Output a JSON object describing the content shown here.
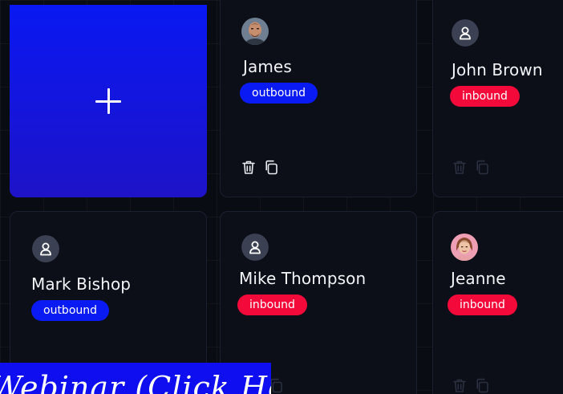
{
  "add_card": {
    "icon": "plus-icon"
  },
  "contacts": [
    {
      "name": "James",
      "direction": "outbound",
      "avatar": "photo-male",
      "actions_active": true
    },
    {
      "name": "John Brown",
      "direction": "inbound",
      "avatar": "person-placeholder",
      "actions_active": false
    },
    {
      "name": "Mark Bishop",
      "direction": "outbound",
      "avatar": "person-placeholder",
      "actions_active": false
    },
    {
      "name": "Mike Thompson",
      "direction": "inbound",
      "avatar": "person-placeholder",
      "actions_active": false
    },
    {
      "name": "Jeanne",
      "direction": "inbound",
      "avatar": "photo-female",
      "actions_active": false
    }
  ],
  "icons": {
    "delete": "trash-icon",
    "copy": "copy-icon"
  },
  "banner": {
    "text": "Webinar (Click Here)"
  },
  "colors": {
    "background": "#0a0c13",
    "card": "#0c0f18",
    "accent_blue": "#0a1af2",
    "inbound_red": "#f3093a"
  }
}
